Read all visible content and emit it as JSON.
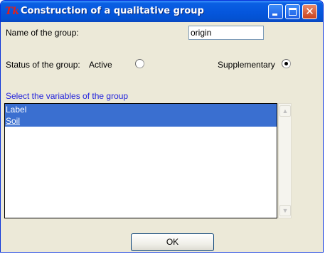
{
  "window": {
    "logo": "Tk",
    "title": "Construction of a qualitative group",
    "close_glyph": "✕"
  },
  "form": {
    "name_label": "Name of the group:",
    "name_value": "origin",
    "status_label": "Status of the group:",
    "active_label": "Active",
    "supplementary_label": "Supplementary",
    "selected_status": "Supplementary",
    "variables_label": "Select the variables of the group",
    "variables": [
      {
        "label": "Label",
        "selected": true
      },
      {
        "label": "Soil",
        "selected": true
      }
    ]
  },
  "buttons": {
    "ok": "OK"
  },
  "colors": {
    "window_bg": "#ece9d8",
    "titlebar": "#0556dc",
    "selection": "#3a6fd0",
    "link_blue": "#2222dd"
  },
  "icons": {
    "minimize": "minimize-icon",
    "maximize": "maximize-icon",
    "close": "close-icon",
    "scroll_up": "scroll-up-arrow-icon",
    "scroll_down": "scroll-down-arrow-icon"
  }
}
